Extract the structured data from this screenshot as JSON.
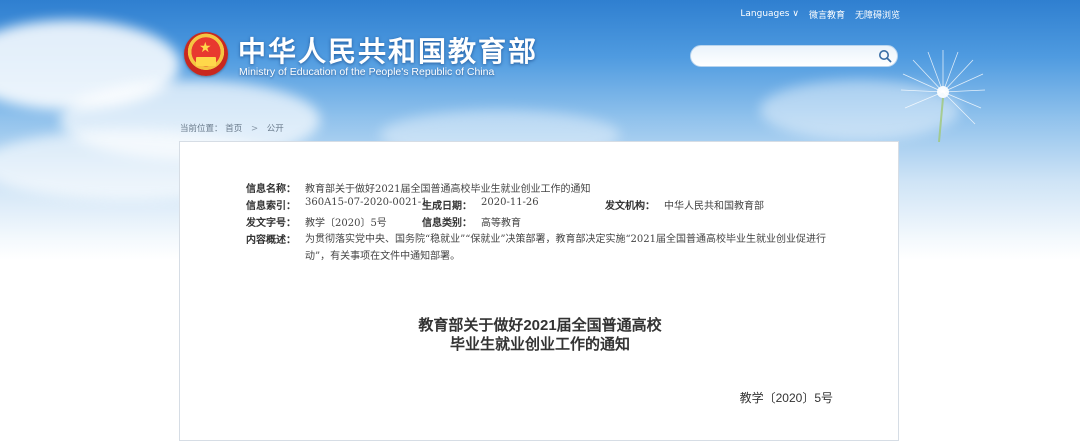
{
  "header": {
    "languages_label": "Languages",
    "links": [
      "微言教育",
      "无障碍浏览"
    ],
    "site_title": "中华人民共和国教育部",
    "site_subtitle": "Ministry of Education of the People's Republic of China",
    "search_placeholder": ""
  },
  "breadcrumb": {
    "label": "当前位置：",
    "items": [
      "首页",
      "公开"
    ]
  },
  "meta": {
    "info_name_label": "信息名称：",
    "info_name_value": "教育部关于做好2021届全国普通高校毕业生就业创业工作的通知",
    "index_label": "信息索引：",
    "index_value": "360A15-07-2020-0021-1",
    "date_label": "生成日期：",
    "date_value": "2020-11-26",
    "issuer_label": "发文机构：",
    "issuer_value": "中华人民共和国教育部",
    "doc_no_label": "发文字号：",
    "doc_no_value": "教学〔2020〕5号",
    "category_label": "信息类别：",
    "category_value": "高等教育",
    "summary_label": "内容概述：",
    "summary_value": "为贯彻落实党中央、国务院“稳就业”“保就业”决策部署，教育部决定实施“2021届全国普通高校毕业生就业创业促进行动”，有关事项在文件中通知部署。"
  },
  "document": {
    "title_line1": "教育部关于做好2021届全国普通高校",
    "title_line2": "毕业生就业创业工作的通知",
    "number": "教学〔2020〕5号"
  }
}
